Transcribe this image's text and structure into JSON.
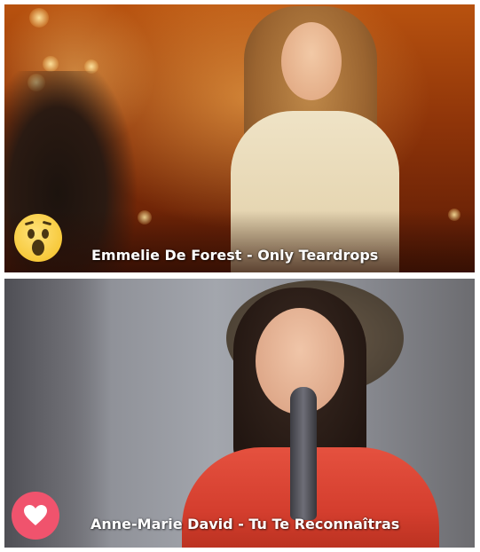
{
  "panels": {
    "top": {
      "caption": "Emmelie De Forest - Only Teardrops",
      "reaction_icon": "wow-face-icon",
      "reaction_color": "#f7c93b"
    },
    "bottom": {
      "caption": "Anne-Marie David - Tu Te Reconnaîtras",
      "reaction_icon": "heart-icon",
      "reaction_color": "#f0536d"
    }
  }
}
